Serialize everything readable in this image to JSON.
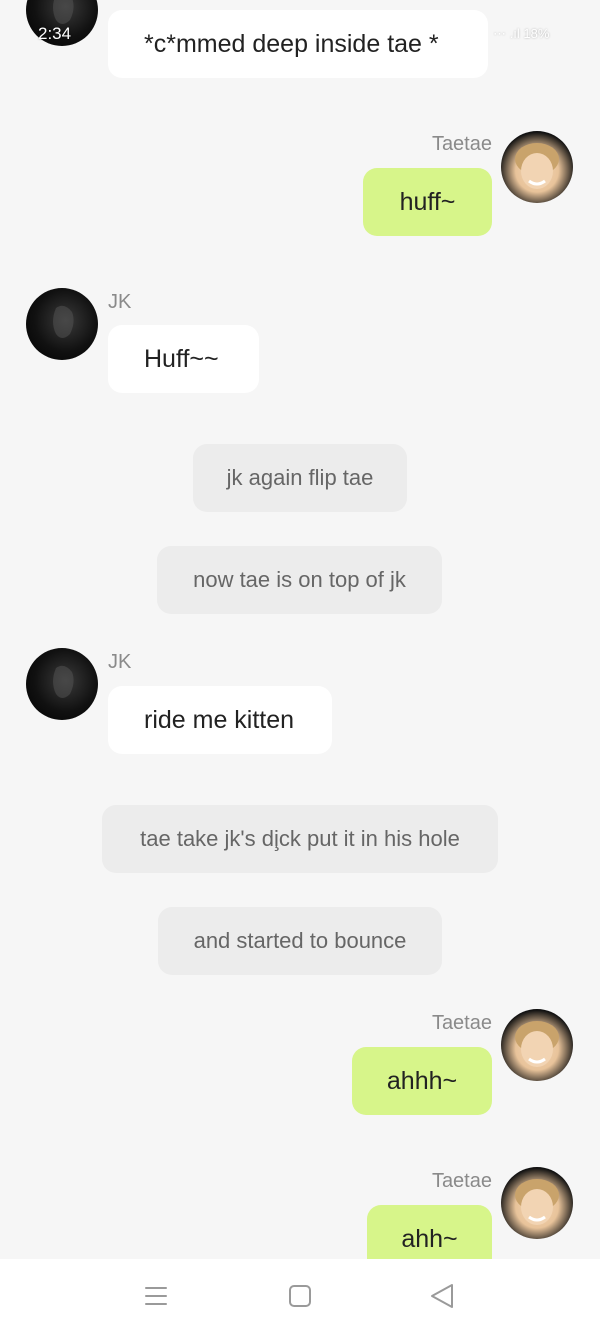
{
  "status_bar": {
    "time": "2:34",
    "right": " ⋯ .ıl 18%"
  },
  "names": {
    "jk": "JK",
    "tae": "Taetae"
  },
  "messages": [
    {
      "text": "*c*mmed deep inside tae *"
    },
    {
      "text": "huff~"
    },
    {
      "text": "Huff~~"
    },
    {
      "text": "jk again flip tae"
    },
    {
      "text": "now tae is on top of jk"
    },
    {
      "text": "ride me kitten"
    },
    {
      "text": "tae take jk's di̧ck put it in his hole"
    },
    {
      "text": "and started to bounce"
    },
    {
      "text": "ahhh~"
    },
    {
      "text": "ahh~"
    }
  ],
  "colors": {
    "background": "#f6f6f6",
    "incoming_bubble": "#ffffff",
    "outgoing_bubble": "#d7f58a",
    "narration_bubble": "#ececec",
    "name_text": "#8a8a8a"
  },
  "nav": {
    "icons": [
      "menu-icon",
      "home-square-icon",
      "back-triangle-icon"
    ]
  }
}
